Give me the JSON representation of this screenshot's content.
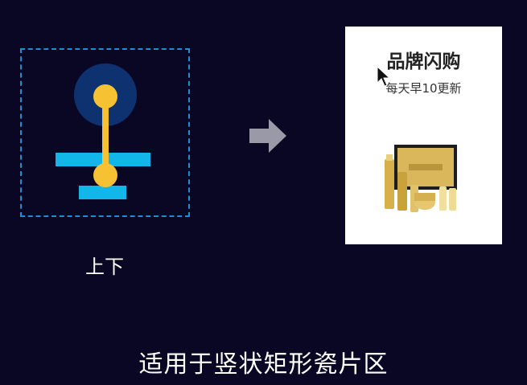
{
  "diagram": {
    "caption": "上下",
    "colors": {
      "frame": "#1b8fd0",
      "circle_bg": "#0e3170",
      "bars": "#12b6e8",
      "pin": "#f6c233"
    }
  },
  "arrow": {
    "icon": "right-arrow-icon",
    "color": "#9a99a8"
  },
  "card": {
    "title": "品牌闪购",
    "subtitle": "每天早10更新"
  },
  "footer": {
    "caption": "适用于竖状矩形瓷片区"
  },
  "colors": {
    "background": "#0a0724"
  }
}
